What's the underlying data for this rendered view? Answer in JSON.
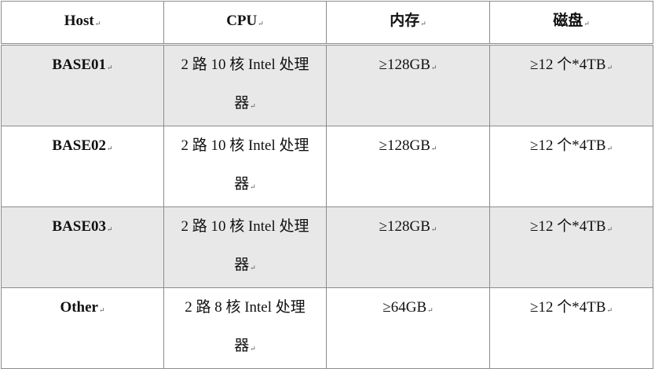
{
  "headers": [
    "Host",
    "CPU",
    "内存",
    "磁盘"
  ],
  "para_mark": "↵",
  "rows": [
    {
      "host": "BASE01",
      "cpu_line1": "2 路 10 核 Intel 处理",
      "cpu_line2": "器",
      "memory": "≥128GB",
      "disk": "≥12 个*4TB",
      "shaded": true
    },
    {
      "host": "BASE02",
      "cpu_line1": "2 路 10 核 Intel 处理",
      "cpu_line2": "器",
      "memory": "≥128GB",
      "disk": "≥12 个*4TB",
      "shaded": false
    },
    {
      "host": "BASE03",
      "cpu_line1": "2 路 10 核 Intel 处理",
      "cpu_line2": "器",
      "memory": "≥128GB",
      "disk": "≥12 个*4TB",
      "shaded": true
    },
    {
      "host": "Other",
      "cpu_line1": "2 路 8 核 Intel 处理",
      "cpu_line2": "器",
      "memory": "≥64GB",
      "disk": "≥12 个*4TB",
      "shaded": false
    }
  ],
  "colors": {
    "border": "#8c8c8c",
    "shade": "#e8e8e8"
  }
}
